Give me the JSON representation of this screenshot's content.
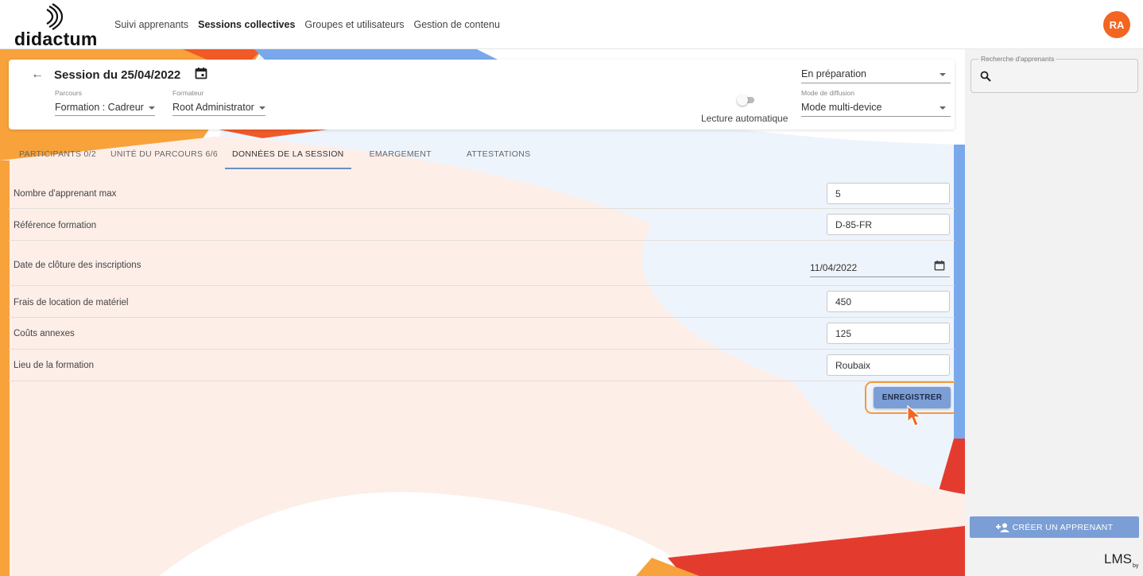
{
  "brand": {
    "name": "didactum"
  },
  "nav": {
    "items": [
      "Suivi apprenants",
      "Sessions collectives",
      "Groupes et utilisateurs",
      "Gestion de contenu"
    ],
    "active": "Sessions collectives"
  },
  "user": {
    "initials": "RA"
  },
  "session": {
    "title": "Session du 25/04/2022",
    "parcours_label": "Parcours",
    "parcours_value": "Formation : Cadreur",
    "formateur_label": "Formateur",
    "formateur_value": "Root Administrator",
    "autoplay_label": "Lecture automatique",
    "autoplay_on": false,
    "status_value": "En préparation",
    "diffusion_label": "Mode de diffusion",
    "diffusion_value": "Mode multi-device"
  },
  "tabs": [
    "PARTICIPANTS 0/2",
    "UNITÉ DU PARCOURS 6/6",
    "DONNÉES DE LA SESSION",
    "EMARGEMENT",
    "ATTESTATIONS"
  ],
  "active_tab": "DONNÉES DE LA SESSION",
  "fields": {
    "max_learners": {
      "label": "Nombre d'apprenant max",
      "value": "5"
    },
    "reference": {
      "label": "Référence formation",
      "value": "D-85-FR"
    },
    "closing_date": {
      "label": "Date de clôture des inscriptions",
      "value": "11/04/2022"
    },
    "equipment_cost": {
      "label": "Frais de location de matériel",
      "value": "450"
    },
    "extra_costs": {
      "label": "Coûts annexes",
      "value": "125"
    },
    "location": {
      "label": "Lieu de la formation",
      "value": "Roubaix"
    }
  },
  "save_label": "ENREGISTRER",
  "sidebar": {
    "search_label": "Recherche d'apprenants",
    "create_label": "CRÉER UN APPRENANT",
    "footer_logo": "LMS",
    "footer_by": "by"
  },
  "colors": {
    "accent": "#7b9ed6",
    "avatar": "#f26522",
    "highlight": "#f39a3d",
    "cursor": "#f26522"
  },
  "icons": [
    "back-arrow-icon",
    "calendar-icon",
    "search-icon",
    "add-person-icon",
    "mouse-cursor-icon",
    "caret-down-icon"
  ]
}
